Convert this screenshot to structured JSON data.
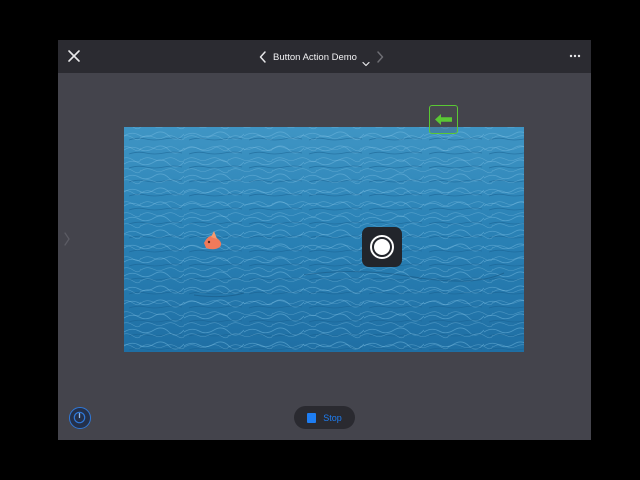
{
  "window": {
    "title": "Button Action Demo"
  },
  "icons": {
    "close": "close-icon",
    "prev": "chevron-left-icon",
    "next": "chevron-right-icon",
    "title_menu": "chevron-down-icon",
    "more": "more-icon",
    "side_panel": "chevron-right-icon",
    "back_arrow": "arrow-left-icon",
    "capture": "capture-icon",
    "gauge": "gauge-icon",
    "stop": "stop-icon"
  },
  "controls": {
    "stop_label": "Stop"
  },
  "colors": {
    "background": "#44444c",
    "toolbar": "#2b2b31",
    "accent_blue": "#1e7df2",
    "accent_green": "#5ac834",
    "water": "#2a83b6"
  }
}
